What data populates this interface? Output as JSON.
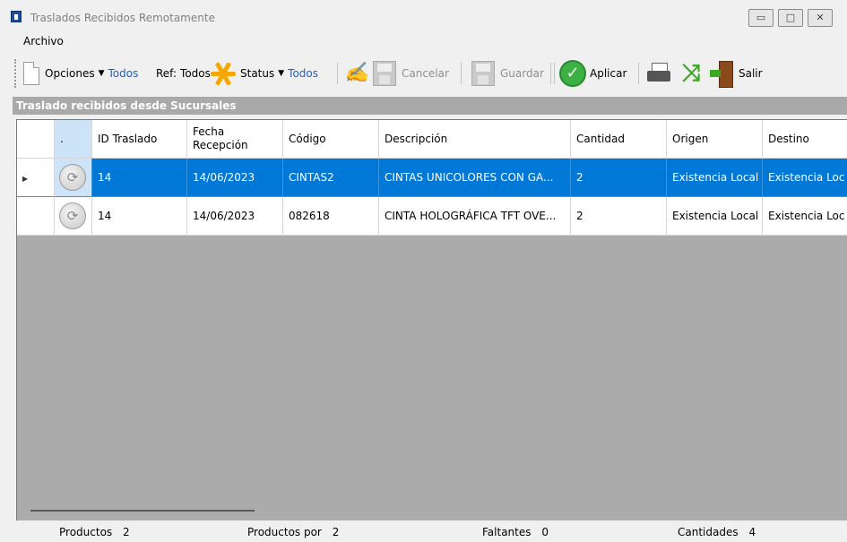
{
  "window": {
    "title": "Traslados Recibidos Remotamente",
    "controls": [
      "minimize-icon",
      "maximize-icon",
      "close-icon"
    ]
  },
  "menu": {
    "file_label": "Archivo"
  },
  "toolbar": {
    "opciones_label": "Opciones",
    "opciones_value": "Todos",
    "ref_label": "Ref:",
    "ref_value": "Todos",
    "status_label": "Status",
    "status_value": "Todos",
    "cancelar_label": "Cancelar",
    "guardar_label": "Guardar",
    "aplicar_label": "Aplicar",
    "salir_label": "Salir"
  },
  "section": {
    "title": "Traslado recibidos desde Sucursales"
  },
  "grid": {
    "columns": [
      ".",
      "ID Traslado",
      "Fecha Recepción",
      "Código",
      "Descripción",
      "Cantidad",
      "Origen",
      "Destino"
    ],
    "rows": [
      {
        "id": "14",
        "fecha": "14/06/2023",
        "codigo": "CINTAS2",
        "descripcion": "CINTAS UNICOLORES CON GA...",
        "cantidad": "2",
        "origen": "Existencia Local",
        "destino": "Existencia Loc",
        "selected": true
      },
      {
        "id": "14",
        "fecha": "14/06/2023",
        "codigo": "082618",
        "descripcion": "CINTA HOLOGRÁFICA TFT OVE...",
        "cantidad": "2",
        "origen": "Existencia Local",
        "destino": "Existencia Loc",
        "selected": false
      }
    ]
  },
  "status": {
    "productos_label": "Productos",
    "productos_value": "2",
    "productos_por_label": "Productos por",
    "productos_por_value": "2",
    "faltantes_label": "Faltantes",
    "faltantes_value": "0",
    "cantidades_label": "Cantidades",
    "cantidades_value": "4"
  },
  "colors": {
    "selection": "#0078d7",
    "link": "#2060c0",
    "section_bg": "#a9a9a9"
  }
}
